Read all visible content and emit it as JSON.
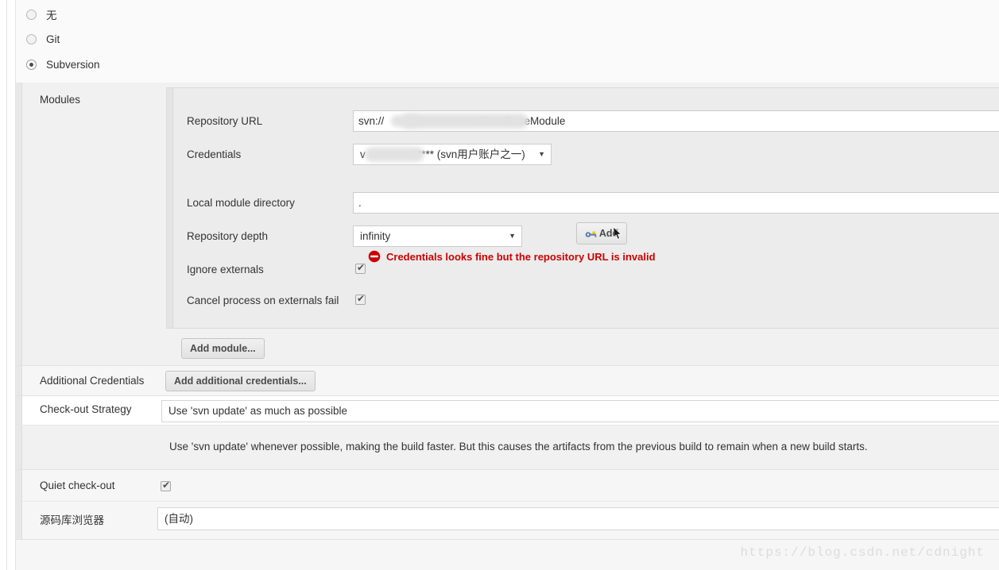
{
  "scm_chooser": {
    "name": "scm-type",
    "options": [
      {
        "label": "无",
        "selected": false
      },
      {
        "label": "Git",
        "selected": false
      },
      {
        "label": "Subversion",
        "selected": true
      }
    ]
  },
  "modules": {
    "section_label": "Modules",
    "fields": {
      "repository_url": {
        "label": "Repository URL",
        "value": "svn://                               .MicroBaseModule",
        "value_prefix": "svn://",
        "value_suffix": ".MicroBaseModule",
        "redacted": true
      },
      "credentials": {
        "label": "Credentials",
        "value": "v                ***** (svn用户账户之一)",
        "value_prefix": "v",
        "value_suffix": "***** (svn用户账户之一)",
        "redacted": true,
        "caret": "▼",
        "add_button": {
          "label": "Add",
          "icon": "key-icon"
        }
      },
      "error": {
        "icon": "stop-circle-icon",
        "text": "Credentials looks fine but the repository URL is invalid",
        "color": "#cc0000"
      },
      "local_module_directory": {
        "label": "Local module directory",
        "value": "."
      },
      "repository_depth": {
        "label": "Repository depth",
        "value": "infinity",
        "caret": "▼"
      },
      "ignore_externals": {
        "label": "Ignore externals",
        "checked": true
      },
      "cancel_process_on_externals_fail": {
        "label": "Cancel process on externals fail",
        "checked": true
      }
    },
    "add_module_button": "Add module..."
  },
  "additional_credentials": {
    "label": "Additional Credentials",
    "button": "Add additional credentials..."
  },
  "checkout_strategy": {
    "label": "Check-out Strategy",
    "value": "Use 'svn update' as much as possible",
    "description": "Use 'svn update' whenever possible, making the build faster. But this causes the artifacts from the previous build to remain when a new build starts."
  },
  "quiet_checkout": {
    "label": "Quiet check-out",
    "checked": true
  },
  "repository_browser": {
    "label": "源码库浏览器",
    "value": "(自动)"
  },
  "watermark": "https://blog.csdn.net/cdnight"
}
